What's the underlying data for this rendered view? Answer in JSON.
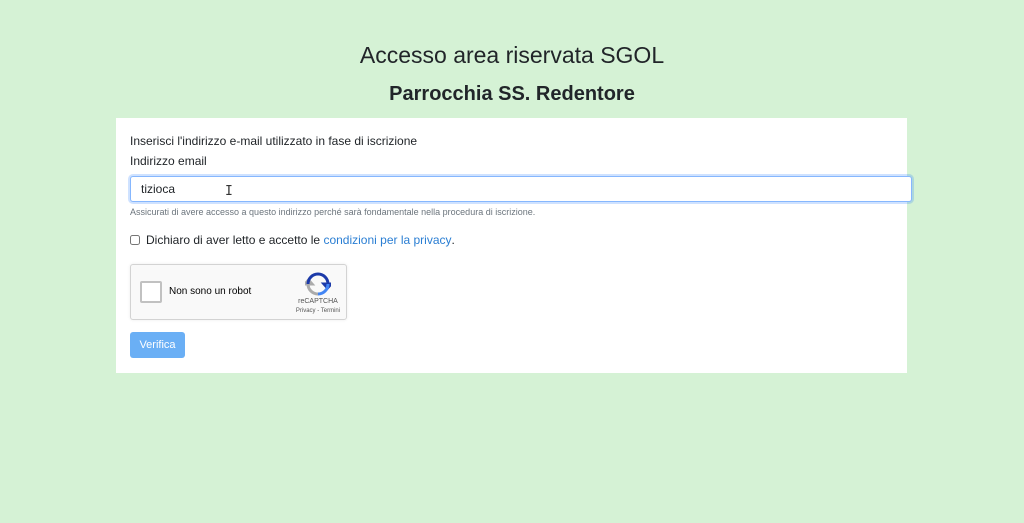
{
  "header": {
    "title": "Accesso area riservata SGOL",
    "subtitle": "Parrocchia SS. Redentore"
  },
  "form": {
    "instructions": "Inserisci l'indirizzo e-mail utilizzato in fase di iscrizione",
    "email_label": "Indirizzo email",
    "email_value": "tizioca",
    "help_text": "Assicurati di avere accesso a questo indirizzo perché sarà fondamentale nella procedura di iscrizione.",
    "privacy_text": "Dichiaro di aver letto e accetto le ",
    "privacy_link": "condizioni per la privacy",
    "privacy_suffix": ".",
    "verify_label": "Verifica"
  },
  "recaptcha": {
    "label": "Non sono un robot",
    "brand": "reCAPTCHA",
    "terms": "Privacy - Termini"
  },
  "colors": {
    "background": "#d5f2d5",
    "link": "#2a7ed3",
    "button": "#6aaff5"
  }
}
